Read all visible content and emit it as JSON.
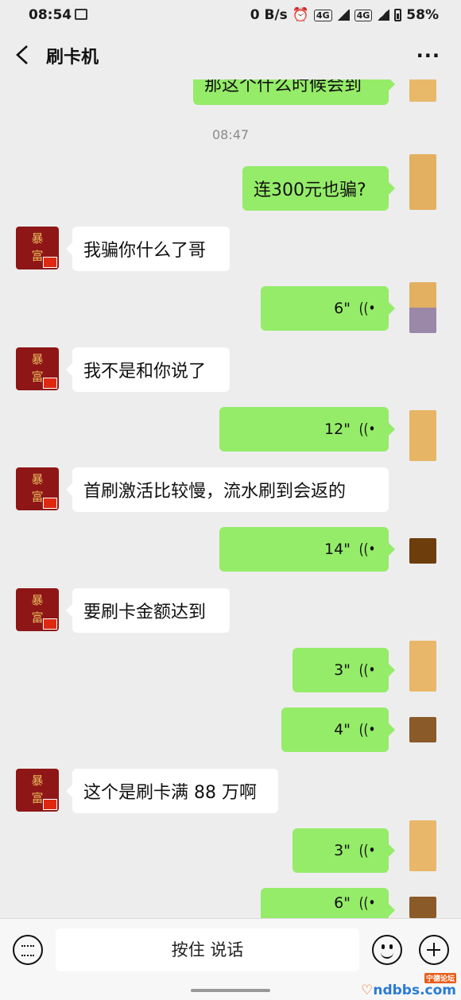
{
  "status_bar": {
    "time": "08:54",
    "net_speed": "0 B/s",
    "net1": "4G",
    "net2": "4G",
    "battery": "58%"
  },
  "nav": {
    "title": "刷卡机",
    "more_label": "···"
  },
  "chat": {
    "partial_top_message": "那这个什么时候会到",
    "timestamp": "08:47",
    "contact_avatar_text": [
      "暴",
      "富"
    ],
    "messages": [
      {
        "side": "out",
        "kind": "text",
        "text": "连300元也骗?"
      },
      {
        "side": "in",
        "kind": "text",
        "text": "我骗你什么了哥"
      },
      {
        "side": "out",
        "kind": "voice",
        "duration": "6\""
      },
      {
        "side": "in",
        "kind": "text",
        "text": "我不是和你说了"
      },
      {
        "side": "out",
        "kind": "voice",
        "duration": "12\""
      },
      {
        "side": "in",
        "kind": "text",
        "text": "首刷激活比较慢，流水刷到会返的"
      },
      {
        "side": "out",
        "kind": "voice",
        "duration": "14\""
      },
      {
        "side": "in",
        "kind": "text",
        "text": "要刷卡金额达到"
      },
      {
        "side": "out",
        "kind": "voice",
        "duration": "3\""
      },
      {
        "side": "out",
        "kind": "voice",
        "duration": "4\""
      },
      {
        "side": "in",
        "kind": "text",
        "text": "这个是刷卡满 88 万啊"
      },
      {
        "side": "out",
        "kind": "voice",
        "duration": "3\""
      },
      {
        "side": "out",
        "kind": "voice",
        "duration": "6\""
      }
    ]
  },
  "input_bar": {
    "hold_to_talk": "按住 说话"
  },
  "watermark": {
    "text": "ndbbs.com",
    "tag": "宁德论坛"
  },
  "colors": {
    "background": "#ededed",
    "outgoing_bubble": "#95ec69",
    "incoming_bubble": "#ffffff",
    "avatar_bg": "#8e1616"
  }
}
